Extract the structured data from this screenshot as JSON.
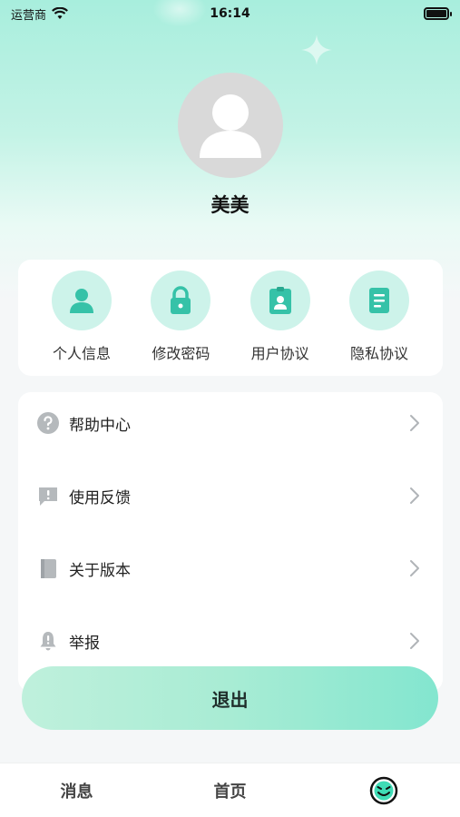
{
  "status_bar": {
    "carrier": "运营商",
    "time": "16:14"
  },
  "profile": {
    "username": "美美"
  },
  "quick_actions": [
    {
      "label": "个人信息",
      "icon": "user-icon"
    },
    {
      "label": "修改密码",
      "icon": "lock-icon"
    },
    {
      "label": "用户协议",
      "icon": "id-badge-icon"
    },
    {
      "label": "隐私协议",
      "icon": "document-icon"
    }
  ],
  "menu": [
    {
      "label": "帮助中心",
      "icon": "help-icon"
    },
    {
      "label": "使用反馈",
      "icon": "feedback-icon"
    },
    {
      "label": "关于版本",
      "icon": "book-icon"
    },
    {
      "label": "举报",
      "icon": "bell-icon"
    }
  ],
  "logout_label": "退出",
  "tabs": [
    {
      "label": "消息"
    },
    {
      "label": "首页"
    },
    {
      "label": "",
      "icon": "smiley-icon"
    }
  ],
  "colors": {
    "accent": "#3fc9b0",
    "header_gradient_top": "#a8eedd",
    "icon_bg": "#cdf3ea",
    "menu_icon_gray": "#b5b9bc"
  }
}
